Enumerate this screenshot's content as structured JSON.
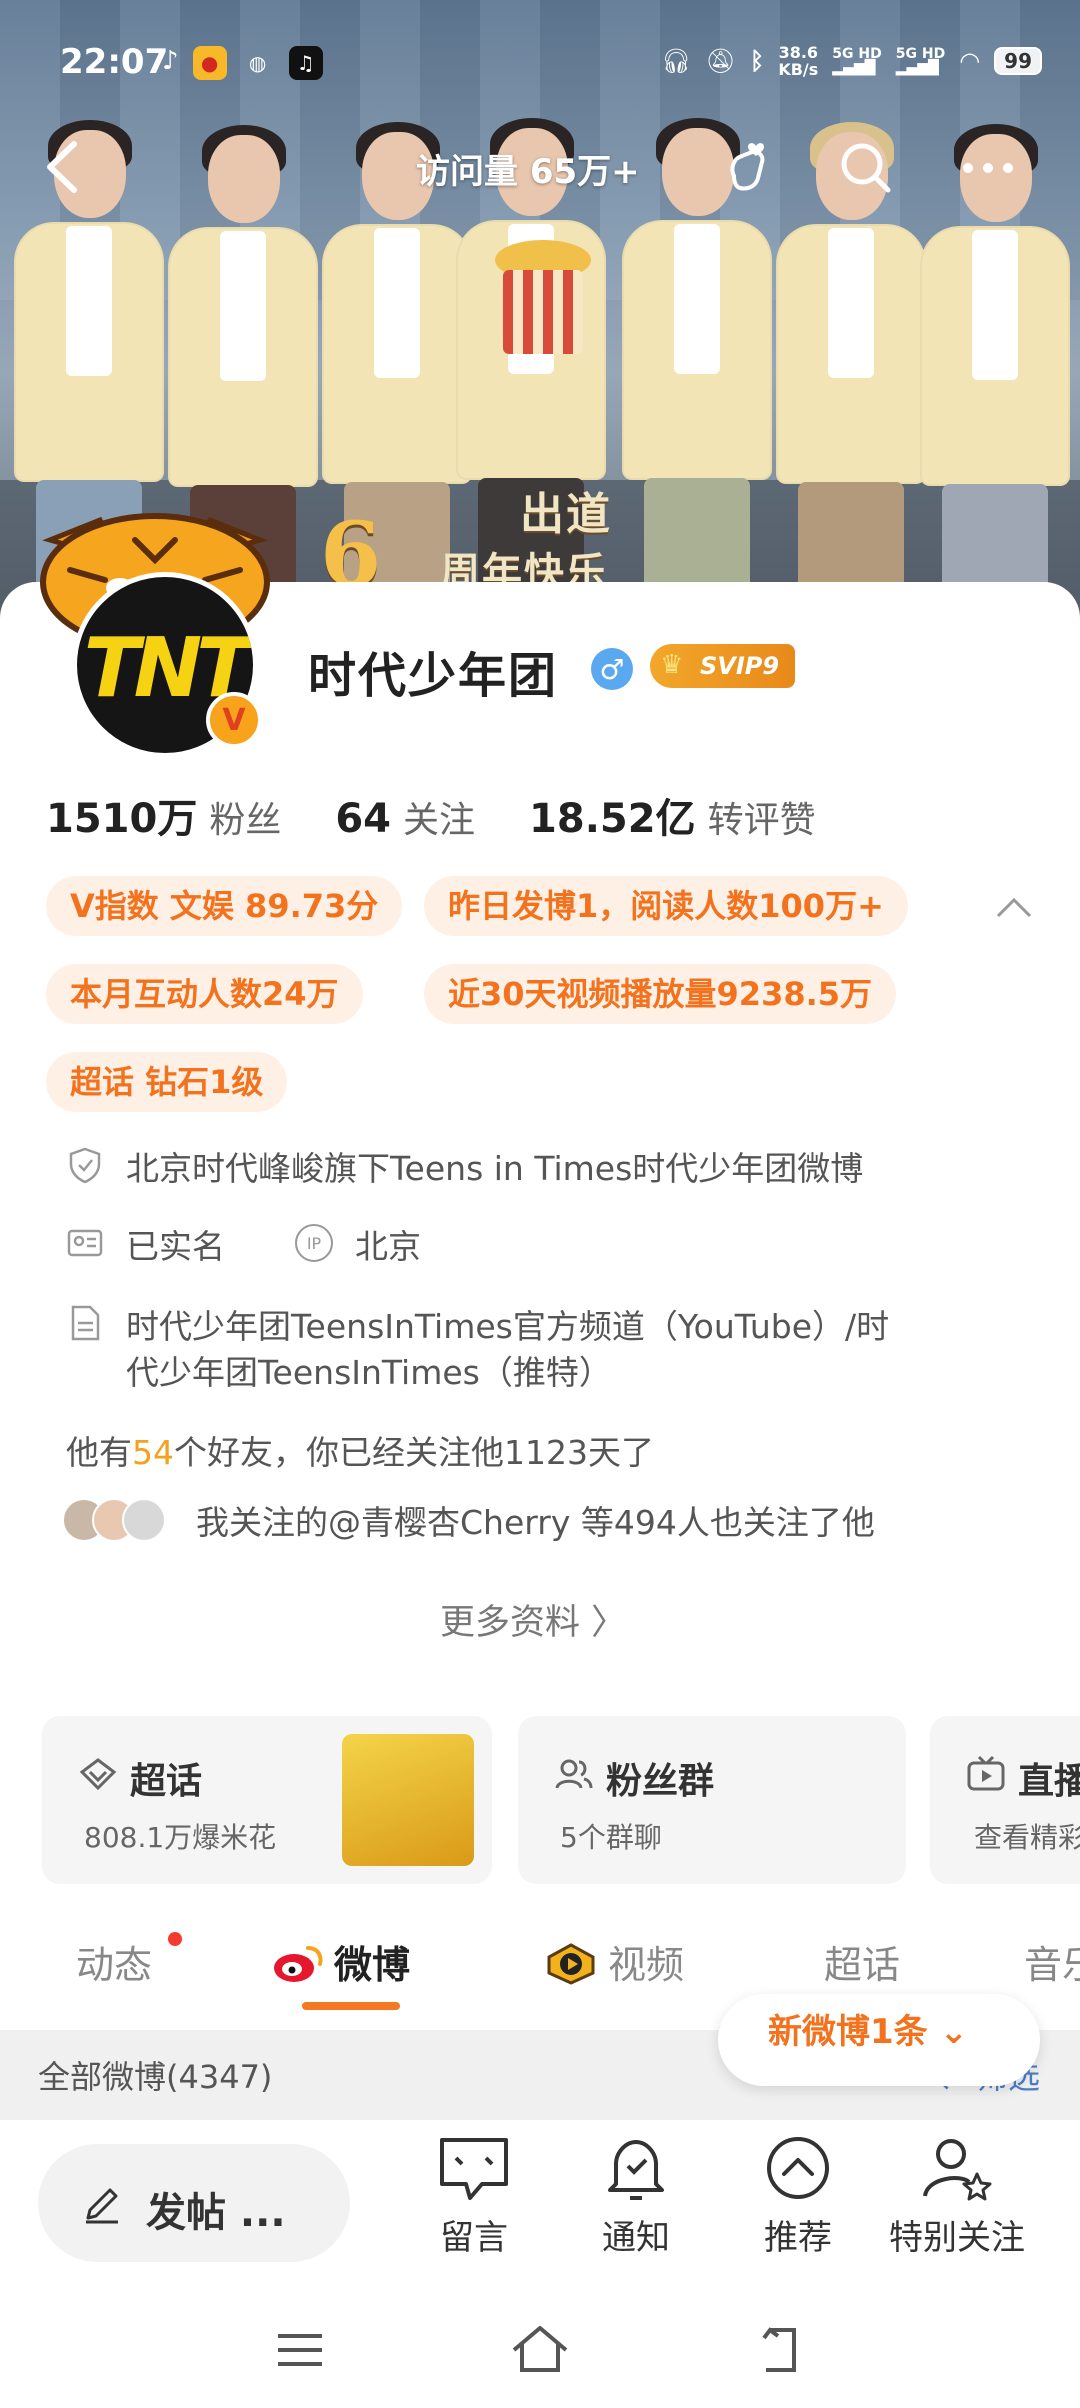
{
  "status_bar": {
    "time": "22:07",
    "net_speed_value": "38.6",
    "net_speed_unit": "KB/s",
    "signal_1": "5G HD",
    "signal_2": "5G HD",
    "battery": "99"
  },
  "header": {
    "visits": "访问量 65万+",
    "banner_main": "出道",
    "banner_number": "6",
    "banner_sub": "周年快乐"
  },
  "profile": {
    "name": "时代少年团",
    "gender_symbol": "♂",
    "svip_label": "SVIP9",
    "verified_badge": "V",
    "stats": [
      {
        "value": "1510万",
        "label": "粉丝"
      },
      {
        "value": "64",
        "label": "关注"
      },
      {
        "value": "18.52亿",
        "label": "转评赞"
      }
    ],
    "chips": [
      "V指数 文娱 89.73分",
      "昨日发博1，阅读人数100万+",
      "本月互动人数24万",
      "近30天视频播放量9238.5万",
      "超话 钻石1级"
    ],
    "verification": "北京时代峰峻旗下Teens in Times时代少年团微博",
    "real_name": "已实名",
    "ip_label": "IP",
    "ip_location": "北京",
    "bio_line1": "时代少年团TeensInTimes官方频道（YouTube）/时",
    "bio_line2": "代少年团TeensInTimes（推特）",
    "friends_prefix": "他有",
    "friends_count": "54",
    "friends_suffix": "个好友，你已经关注他1123天了",
    "mutual_text": "我关注的@青樱杏Cherry 等494人也关注了他",
    "more_info": "更多资料 〉"
  },
  "tiles": [
    {
      "title": "超话",
      "sub": "808.1万爆米花"
    },
    {
      "title": "粉丝群",
      "sub": "5个群聊"
    },
    {
      "title": "直播",
      "sub": "查看精彩"
    }
  ],
  "tabs": [
    "动态",
    "微博",
    "视频",
    "超话",
    "音乐"
  ],
  "feed": {
    "all_label": "全部微博(4347)",
    "filter_label": "筛选",
    "new_pill": "新微博1条 ⌄"
  },
  "bottom_bar": {
    "post_label": "发帖 ...",
    "actions": [
      "留言",
      "通知",
      "推荐",
      "特别关注"
    ]
  },
  "colors": {
    "accent_orange": "#f3721e",
    "chip_bg": "#fff0e6",
    "link_blue": "#4a7dc9",
    "gender_blue": "#5aa9f0"
  }
}
